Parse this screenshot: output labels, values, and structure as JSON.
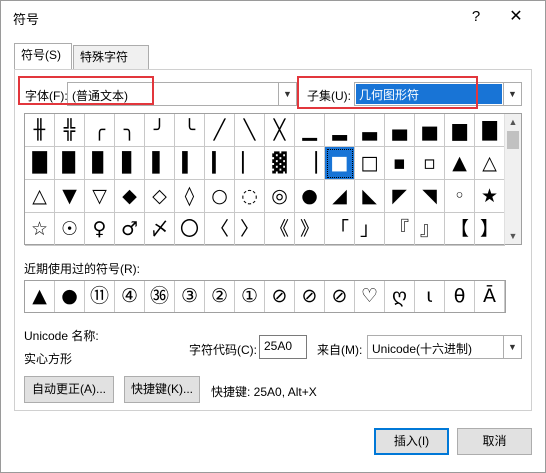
{
  "window": {
    "title": "符号",
    "help": "?",
    "close": "✕"
  },
  "tabs": [
    "符号(S)",
    "特殊字符(P)"
  ],
  "font": {
    "label": "字体(F):",
    "value": "(普通文本)"
  },
  "subset": {
    "label": "子集(U):",
    "value": "几何图形符"
  },
  "symbols": [
    "╫",
    "╬",
    "╭",
    "╮",
    "╯",
    "╰",
    "╱",
    "╲",
    "╳",
    "▁",
    "▂",
    "▃",
    "▄",
    "▅",
    "▆",
    "▇",
    "█",
    "▉",
    "▊",
    "▋",
    "▌",
    "▍",
    "▎",
    "▏",
    "▓",
    "▕",
    "■",
    "□",
    "▪",
    "▫",
    "▲",
    "△",
    "△",
    "▼",
    "▽",
    "◆",
    "◇",
    "◊",
    "○",
    "◌",
    "◎",
    "●",
    "◢",
    "◣",
    "◤",
    "◥",
    "◦",
    "★",
    "☆",
    "☉",
    "♀",
    "♂",
    "〆",
    "〇",
    "〈",
    "〉",
    "《",
    "》",
    "「",
    "」",
    "『",
    "』",
    "【",
    "】"
  ],
  "selected_symbol_index": 26,
  "colors": {
    "highlight": "#e2363c",
    "selection": "#1874d6",
    "subset_selection": "#1874d6"
  },
  "recent": {
    "label": "近期使用过的符号(R):",
    "items": [
      "▲",
      "●",
      "⑪",
      "④",
      "㊱",
      "③",
      "②",
      "①",
      "⊘",
      "⊘",
      "⊘",
      "♡",
      "ღ",
      "ι",
      "θ",
      "Ā"
    ]
  },
  "unicode_name": {
    "label": "Unicode 名称:",
    "value": "实心方形"
  },
  "char_code": {
    "label": "字符代码(C):",
    "value": "25A0"
  },
  "from": {
    "label": "来自(M):",
    "value": "Unicode(十六进制)"
  },
  "buttons": {
    "autocorrect": "自动更正(A)...",
    "shortcut_key": "快捷键(K)...",
    "insert": "插入(I)",
    "cancel": "取消"
  },
  "shortcut_text": "快捷键: 25A0, Alt+X"
}
